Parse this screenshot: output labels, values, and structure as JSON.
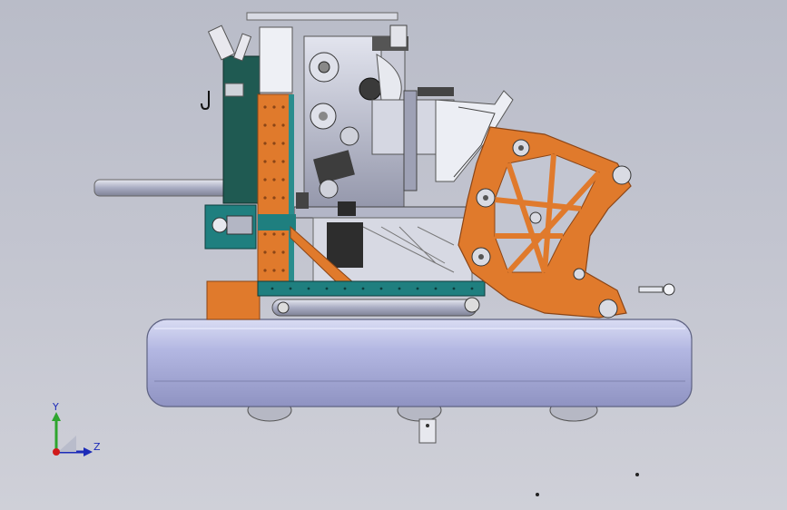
{
  "viewport": {
    "background_top": "#b9bcc8",
    "background_bottom": "#cfd0d8"
  },
  "model": {
    "colors": {
      "orange": "#e07a2c",
      "orange_dark": "#a9541a",
      "teal": "#1f7f7f",
      "dark_green": "#1f5a52",
      "steel": "#c7c9d6",
      "steel_dark": "#8d90a2",
      "pontoon": "#b9bde6",
      "pontoon_edge": "#6b6f8c"
    }
  },
  "triad": {
    "y_label": "Y",
    "z_label": "Z",
    "y_color": "#2ea52e",
    "z_color": "#1c2bb8",
    "origin_color": "#d01a1a"
  }
}
